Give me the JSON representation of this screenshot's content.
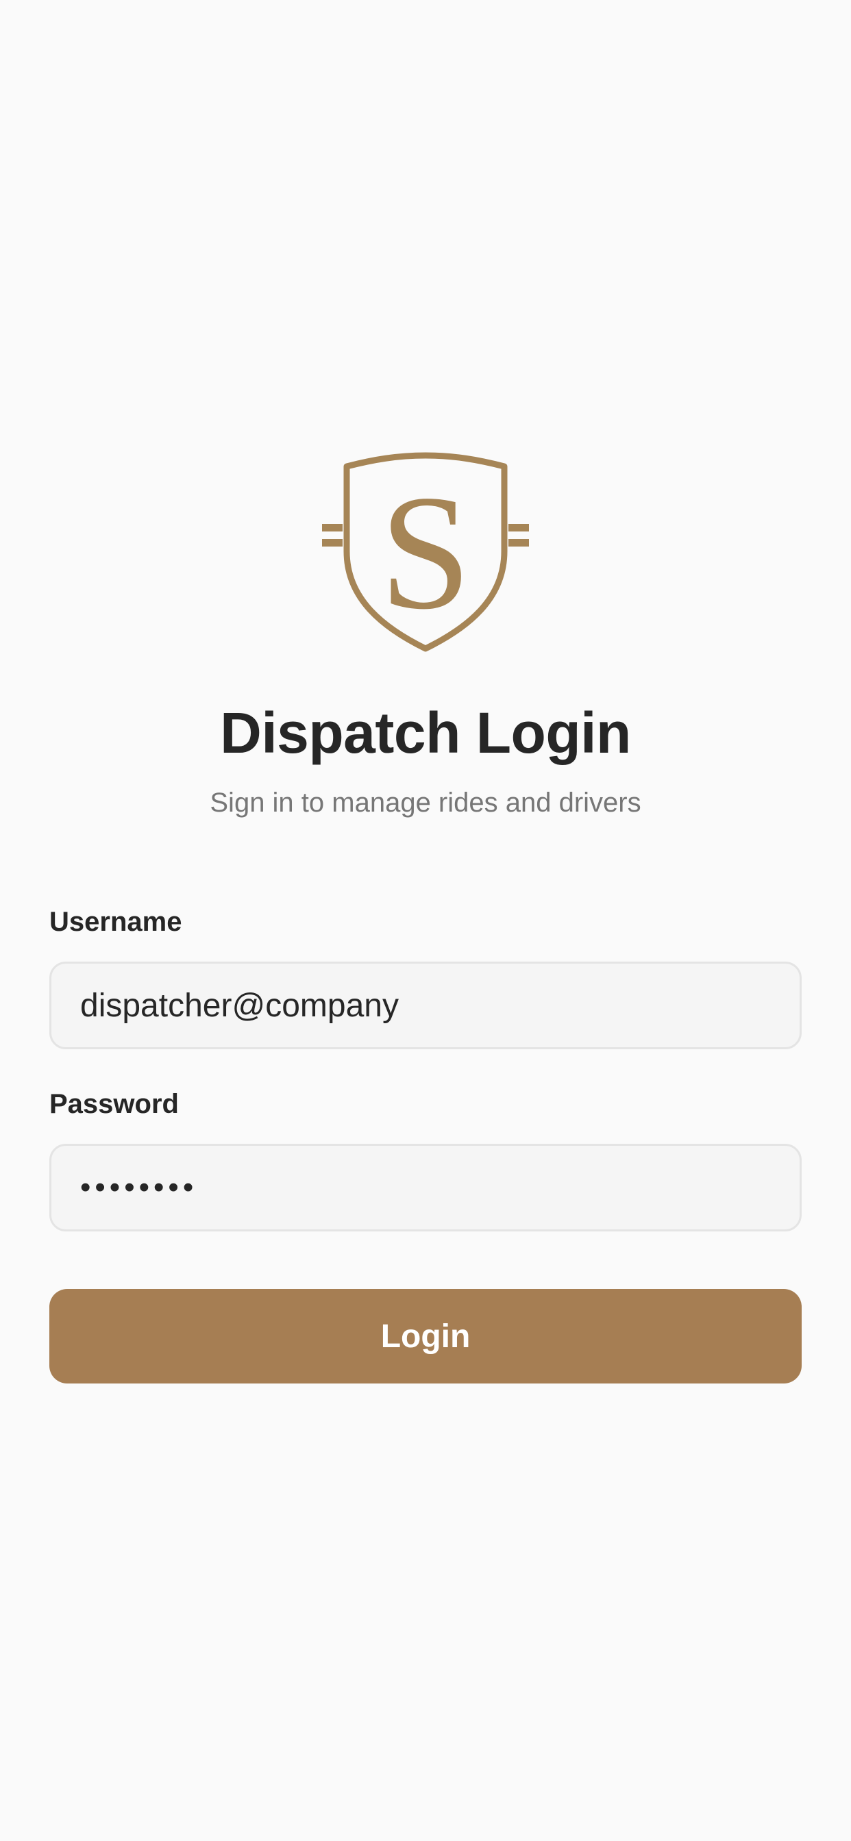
{
  "brand": {
    "logo_letter": "S",
    "accent_color": "#a67e53",
    "logo_icon": "shield-s-icon"
  },
  "header": {
    "title": "Dispatch Login",
    "subtitle": "Sign in to manage rides and drivers"
  },
  "form": {
    "username": {
      "label": "Username",
      "value": "dispatcher@company"
    },
    "password": {
      "label": "Password",
      "value": "••••••••"
    },
    "login_label": "Login"
  }
}
